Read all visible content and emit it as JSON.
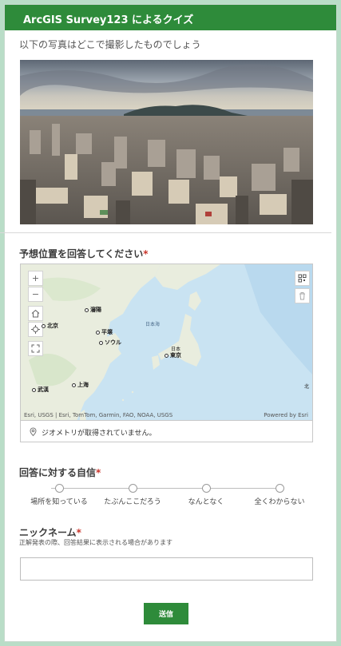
{
  "header": {
    "title": "ArcGIS Survey123 によるクイズ"
  },
  "question_photo": {
    "label": "以下の写真はどこで撮影したものでしょう"
  },
  "question_location": {
    "label": "予想位置を回答してください",
    "required_mark": "*",
    "map": {
      "place_labels": [
        "北京",
        "瀋陽",
        "平壌",
        "ソウル",
        "日本海",
        "日本",
        "東京",
        "武漢",
        "上海",
        "北"
      ],
      "attribution": "Esri, USGS | Esri, TomTom, Garmin, FAO, NOAA, USGS",
      "powered_by": "Powered by Esri",
      "controls": {
        "zoom_in": "+",
        "zoom_out": "−"
      }
    },
    "status": "ジオメトリが取得されていません。"
  },
  "question_confidence": {
    "label": "回答に対する自信",
    "required_mark": "*",
    "options": [
      "場所を知っている",
      "たぶんここだろう",
      "なんとなく",
      "全くわからない"
    ]
  },
  "question_nickname": {
    "label": "ニックネーム",
    "required_mark": "*",
    "hint": "正解発表の際、回答結果に表示される場合があります",
    "value": "",
    "placeholder": ""
  },
  "submit": {
    "label": "送信"
  },
  "colors": {
    "brand": "#2e8b3a",
    "required": "#c9352b",
    "background": "#b9ddc7"
  }
}
